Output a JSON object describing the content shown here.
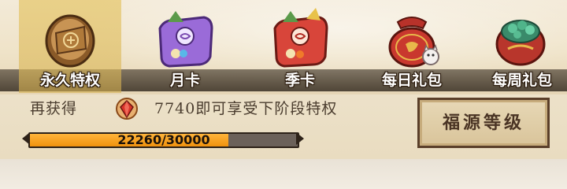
{
  "tabs": [
    {
      "label": "永久特权",
      "icon": "scroll-token-icon",
      "selected": true
    },
    {
      "label": "月卡",
      "icon": "purple-giftbag-icon",
      "selected": false
    },
    {
      "label": "季卡",
      "icon": "red-giftbag-icon",
      "selected": false
    },
    {
      "label": "每日礼包",
      "icon": "lucky-bag-icon",
      "selected": false
    },
    {
      "label": "每周礼包",
      "icon": "jade-treasure-icon",
      "selected": false
    }
  ],
  "progress": {
    "prefix": "再获得",
    "currency_icon": "red-gem-icon",
    "message": "7740即可享受下阶段特权",
    "bar_text": "22260/30000",
    "current": 22260,
    "max": 30000
  },
  "level_button": {
    "label": "福源等级"
  },
  "colors": {
    "accent": "#f0920e",
    "selected_tab": "#e0c06a",
    "text_dark": "#4a3c2e"
  }
}
